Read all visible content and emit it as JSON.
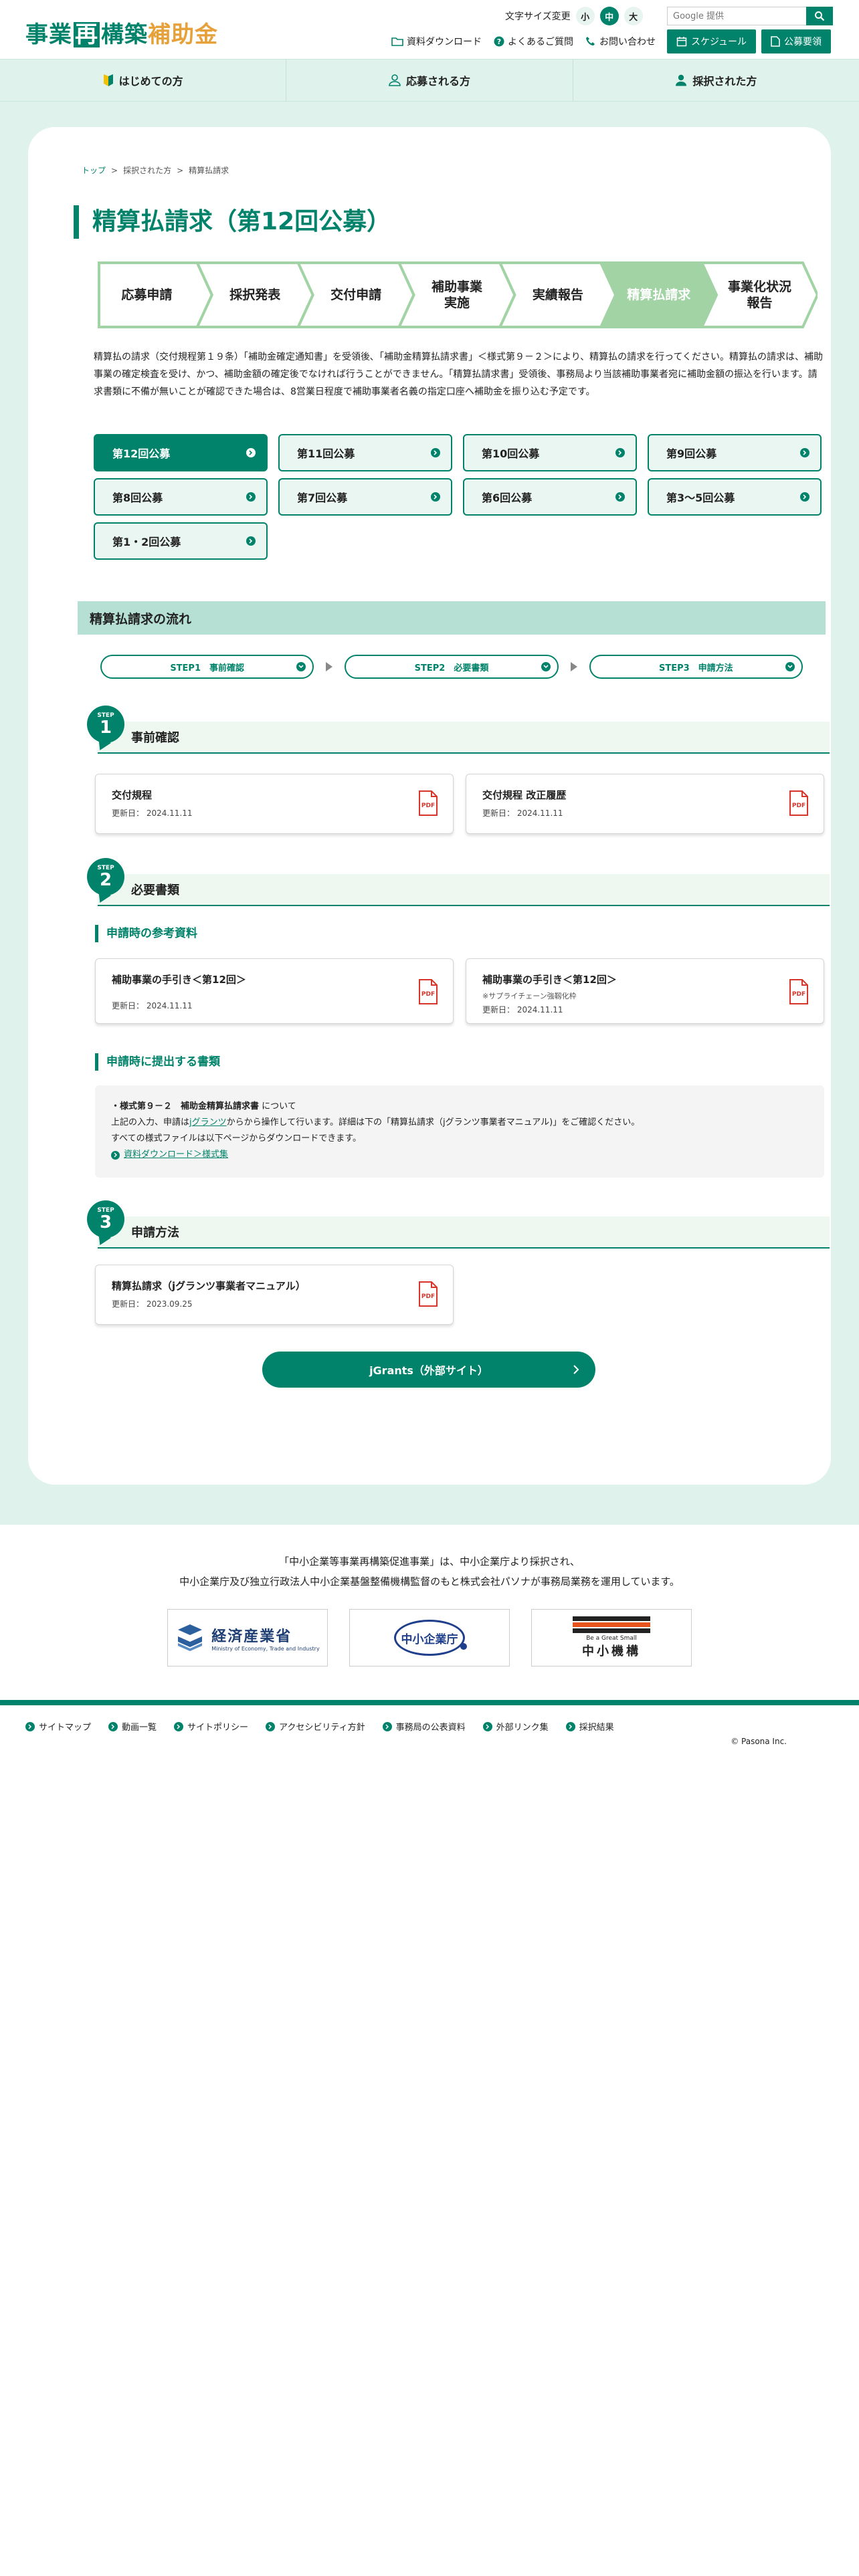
{
  "header": {
    "logo": {
      "part1": "事業",
      "boxed": "再",
      "part2": "構築",
      "orange": "補助金"
    },
    "font_size_label": "文字サイズ変更",
    "font_sizes": [
      "小",
      "中",
      "大"
    ],
    "search_placeholder": "Google 提供",
    "links": [
      "資料ダウンロード",
      "よくあるご質問",
      "お問い合わせ"
    ],
    "buttons": [
      "スケジュール",
      "公募要領"
    ]
  },
  "nav": [
    "はじめての方",
    "応募される方",
    "採択された方"
  ],
  "breadcrumb": [
    "トップ",
    "採択された方",
    "精算払請求"
  ],
  "page_title": "精算払請求（第12回公募）",
  "flow": {
    "steps": [
      "応募申請",
      "採択発表",
      "交付申請",
      "補助事業\n実施",
      "実績報告",
      "精算払請求",
      "事業化状況\n報告"
    ],
    "current": 5
  },
  "intro": "精算払の請求（交付規程第１９条）「補助金確定通知書」を受領後､「補助金精算払請求書」＜様式第９－２＞により、精算払の請求を行ってください。精算払の請求は、補助事業の確定検査を受け、かつ、補助金額の確定後でなければ行うことができません。｢精算払請求書」受領後、事務局より当該補助事業者宛に補助金額の振込を行います。請求書類に不備が無いことが確認できた場合は、8営業日程度で補助事業者名義の指定口座へ補助金を振り込む予定です。",
  "rounds": [
    "第12回公募",
    "第11回公募",
    "第10回公募",
    "第9回公募",
    "第8回公募",
    "第7回公募",
    "第6回公募",
    "第3～5回公募",
    "第1・2回公募"
  ],
  "flow_section_title": "精算払請求の流れ",
  "step_pills": [
    "STEP1　事前確認",
    "STEP2　必要書類",
    "STEP3　申請方法"
  ],
  "step_label": "STEP",
  "step1": {
    "num": "1",
    "title": "事前確認",
    "docs": [
      {
        "title": "交付規程",
        "date": "更新日： 2024.11.11"
      },
      {
        "title": "交付規程 改正履歴",
        "date": "更新日： 2024.11.11"
      }
    ]
  },
  "step2": {
    "num": "2",
    "title": "必要書類",
    "ref_title": "申請時の参考資料",
    "docs": [
      {
        "title": "補助事業の手引き＜第12回＞",
        "date": "更新日： 2024.11.11"
      },
      {
        "title": "補助事業の手引き＜第12回＞",
        "sub": "※サプライチェーン強靱化枠",
        "date": "更新日： 2024.11.11"
      }
    ],
    "submit_title": "申請時に提出する書類",
    "notice": {
      "line1_bold": "・様式第９－２　補助金精算払請求書",
      "line1_rest": "について",
      "line2_a": "上記の入力、申請は",
      "line2_link": "jグランツ",
      "line2_b": "からから操作して行います。詳細は下の「精算払請求（jグランツ事業者マニュアル)」をご確認ください。",
      "line3": "すべての様式ファイルは以下ページからダウンロードできます。",
      "link": "資料ダウンロード＞様式集"
    }
  },
  "step3": {
    "num": "3",
    "title": "申請方法",
    "docs": [
      {
        "title": "精算払請求（jグランツ事業者マニュアル）",
        "date": "更新日： 2023.09.25"
      }
    ]
  },
  "jgrants_button": "jGrants（外部サイト）",
  "footer": {
    "line1": "「中小企業等事業再構築促進事業」は、中小企業庁より採択され、",
    "line2": "中小企業庁及び独立行政法人中小企業基盤整備機構監督のもと株式会社パソナが事務局業務を運用しています。",
    "logos": {
      "meti_main": "経済産業省",
      "meti_sub": "Ministry of Economy, Trade and Industry",
      "chusho": "中小企業庁",
      "smrj_sub": "Be a Great Small",
      "smrj_main": "中小機構"
    },
    "links": [
      "サイトマップ",
      "動画一覧",
      "サイトポリシー",
      "アクセシビリティ方針",
      "事務局の公表資料",
      "外部リンク集",
      "採択結果"
    ],
    "copyright": "© Pasona Inc."
  },
  "colors": {
    "brand": "#00836a",
    "accent_orange": "#e6a13b",
    "light_green": "#dff2ec",
    "flow_current": "#a2d3a4"
  }
}
